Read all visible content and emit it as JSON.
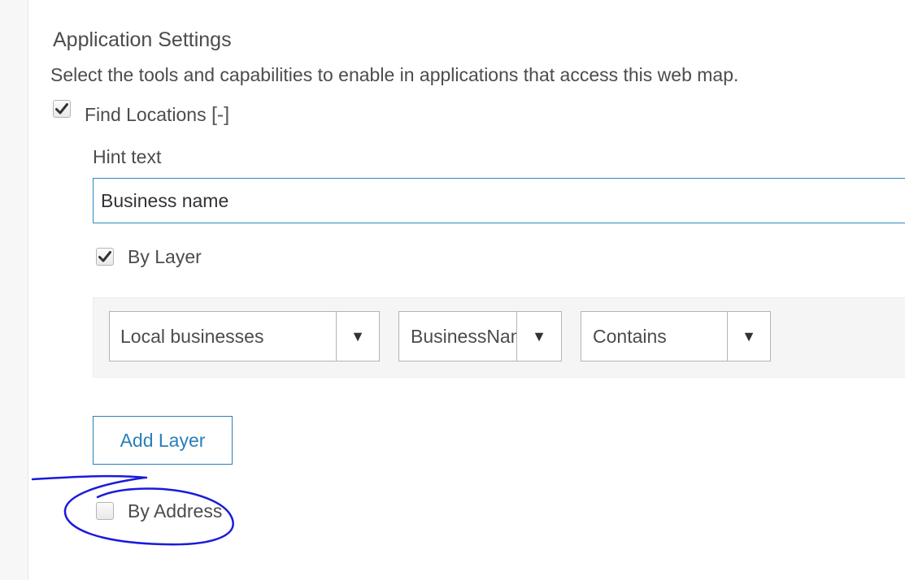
{
  "settings": {
    "title": "Application Settings",
    "description": "Select the tools and capabilities to enable in applications that access this web map."
  },
  "find_locations": {
    "label": "Find Locations",
    "toggle": "[-]",
    "checked": true,
    "hint_text_label": "Hint text",
    "hint_text_value": "Business name",
    "by_layer": {
      "label": "By Layer",
      "checked": true,
      "layer_select": "Local businesses",
      "field_select": "BusinessName",
      "operator_select": "Contains",
      "arrow_glyph": "▼"
    },
    "add_layer_label": "Add Layer",
    "by_address": {
      "label": "By Address",
      "checked": false
    }
  },
  "colors": {
    "accent": "#2a7fb8",
    "annotation": "#1a1adb",
    "text": "#4c4c4c"
  },
  "icons": {
    "checkbox_checked": "checkmark-icon",
    "dropdown": "triangle-down-icon"
  }
}
